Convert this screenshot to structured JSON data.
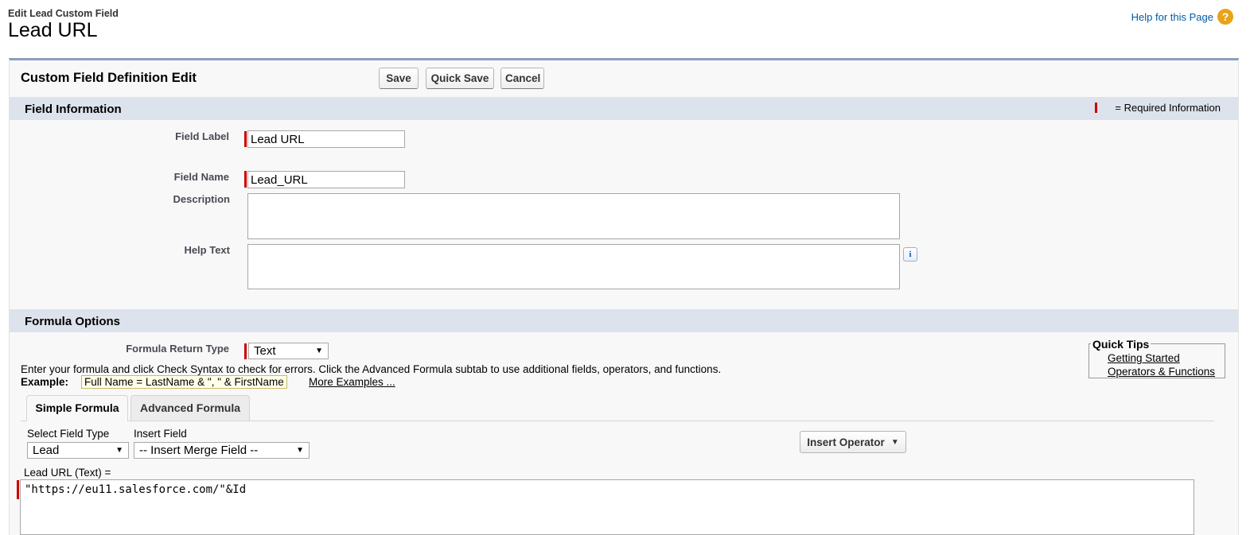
{
  "page_header": {
    "subtitle": "Edit Lead Custom Field",
    "title": "Lead URL",
    "help_link": "Help for this Page",
    "help_icon_glyph": "?"
  },
  "block": {
    "title": "Custom Field Definition Edit",
    "buttons": {
      "save": "Save",
      "quick_save": "Quick Save",
      "cancel": "Cancel"
    }
  },
  "field_info": {
    "section_title": "Field Information",
    "required_text": "= Required Information",
    "field_label": {
      "label": "Field Label",
      "value": "Lead URL"
    },
    "field_name": {
      "label": "Field Name",
      "value": "Lead_URL"
    },
    "description": {
      "label": "Description",
      "value": ""
    },
    "help_text": {
      "label": "Help Text",
      "value": ""
    },
    "info_icon_glyph": "i"
  },
  "formula_options": {
    "section_title": "Formula Options",
    "return_type": {
      "label": "Formula Return Type",
      "value": "Text"
    },
    "instructions": "Enter your formula and click Check Syntax to check for errors. Click the Advanced Formula subtab to use additional fields, operators, and functions.",
    "example_label": "Example:",
    "example_value": "Full Name = LastName & \", \" & FirstName",
    "more_examples": "More Examples ...",
    "quick_tips": {
      "title": "Quick Tips",
      "links": [
        "Getting Started",
        "Operators & Functions"
      ]
    },
    "tabs": [
      {
        "label": "Simple Formula",
        "active": true
      },
      {
        "label": "Advanced Formula",
        "active": false
      }
    ],
    "select_field_type": {
      "label": "Select Field Type",
      "value": "Lead"
    },
    "insert_field": {
      "label": "Insert Field",
      "value": "-- Insert Merge Field --"
    },
    "insert_operator": "Insert Operator",
    "formula_label": "Lead URL (Text) =",
    "formula_value": "\"https://eu11.salesforce.com/\"&Id"
  },
  "colors": {
    "section_bar": "#dde3ec",
    "required": "#cc0000",
    "link": "#015ba7",
    "block_top_border": "#8e9dbd"
  }
}
